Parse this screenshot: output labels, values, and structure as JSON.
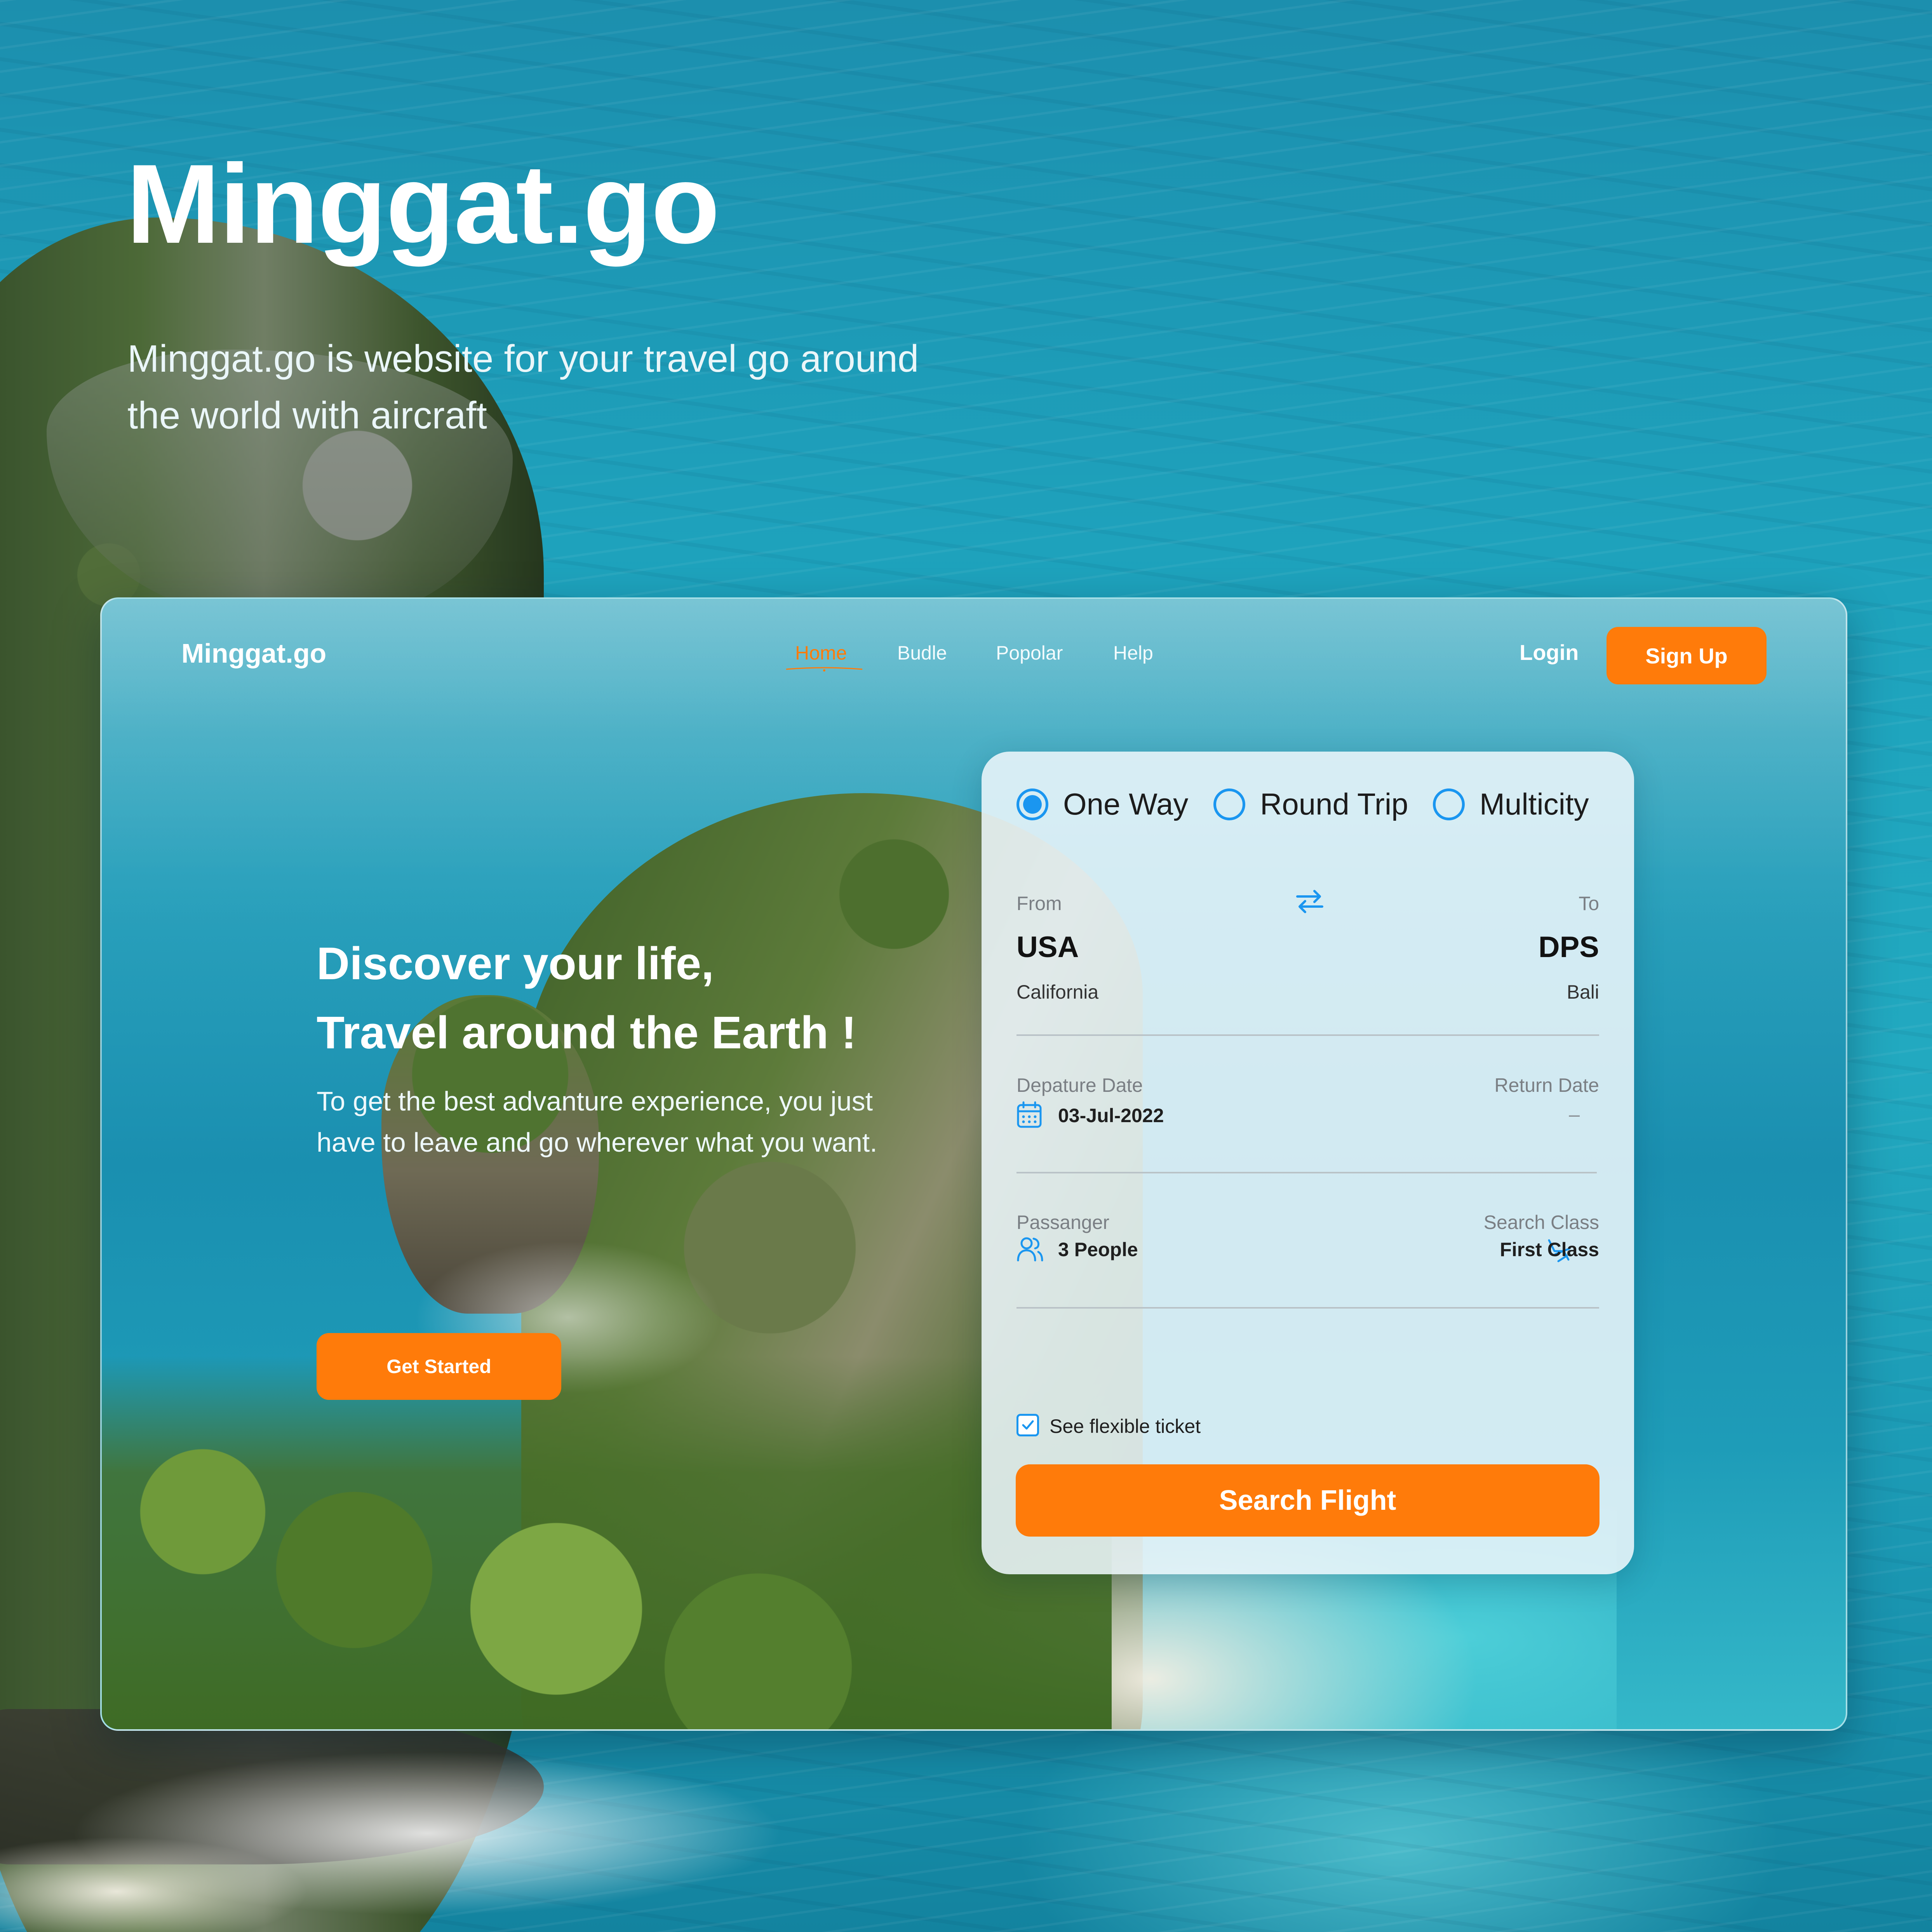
{
  "hero": {
    "brand": "Minggat.go",
    "description": "Minggat.go is website for your travel go around the world with aircraft"
  },
  "nav": {
    "logo": "Minggat.go",
    "links": [
      "Home",
      "Budle",
      "Popolar",
      "Help"
    ],
    "active": "Home",
    "login": "Login",
    "signup": "Sign Up"
  },
  "landing": {
    "title_line1": "Discover your life,",
    "title_line2": "Travel around the Earth !",
    "description": "To get the best advanture experience, you just have to leave and go wherever what you want.",
    "cta": "Get Started"
  },
  "booking": {
    "trip_types": [
      {
        "label": "One Way",
        "selected": true
      },
      {
        "label": "Round Trip",
        "selected": false
      },
      {
        "label": "Multicity",
        "selected": false
      }
    ],
    "from": {
      "label": "From",
      "code": "USA",
      "city": "California"
    },
    "to": {
      "label": "To",
      "code": "DPS",
      "city": "Bali"
    },
    "departure": {
      "label": "Depature Date",
      "value": "03-Jul-2022"
    },
    "return": {
      "label": "Return Date",
      "value": "–"
    },
    "passenger": {
      "label": "Passanger",
      "value": "3 People"
    },
    "class": {
      "label": "Search Class",
      "value": "First Class"
    },
    "flexible": {
      "label": "See flexible ticket",
      "checked": true
    },
    "search_button": "Search Flight"
  },
  "colors": {
    "accent": "#ff7b0a",
    "radio": "#1a96f0"
  },
  "icons": [
    "swap-icon",
    "calendar-icon",
    "people-icon",
    "seat-icon",
    "checkmark-icon"
  ]
}
